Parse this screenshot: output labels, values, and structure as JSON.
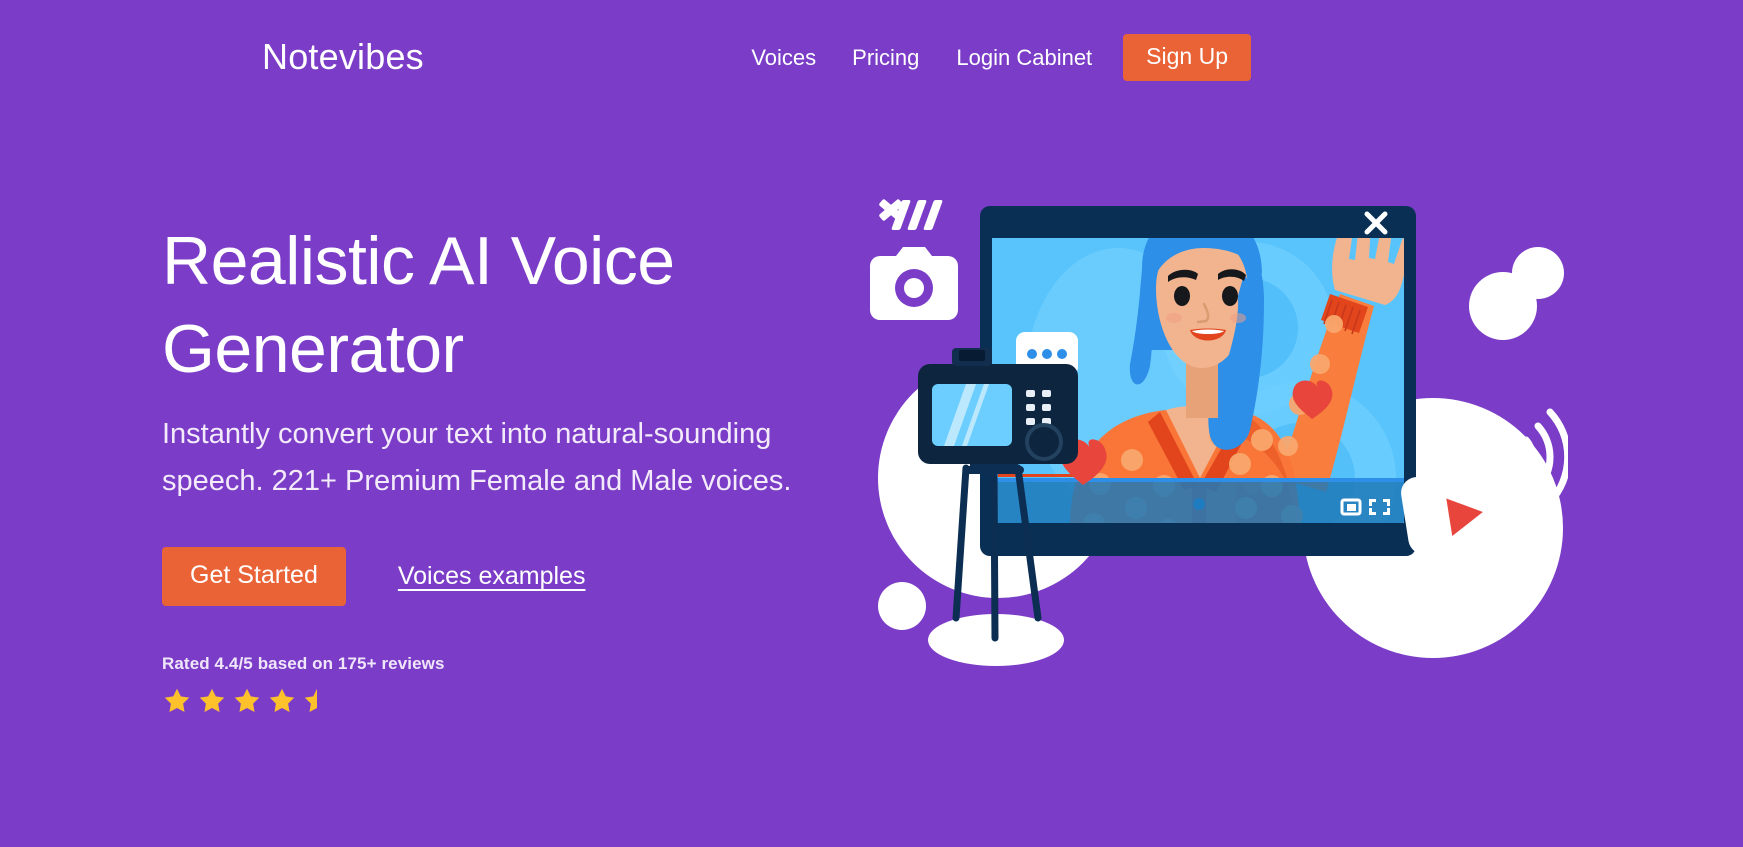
{
  "theme": {
    "background": "#7B3DC8",
    "accent_orange": "#EA6337",
    "text_white": "#FFFFFF",
    "star_gold": "#FCC12B",
    "frame_navy": "#092F55",
    "screen_blue": "#59C4FC",
    "heart_red": "#E8453C"
  },
  "header": {
    "brand": "Notevibes",
    "nav": [
      {
        "label": "Voices",
        "name": "nav-link-voices"
      },
      {
        "label": "Pricing",
        "name": "nav-link-pricing"
      },
      {
        "label": "Login Cabinet",
        "name": "nav-link-login-cabinet"
      }
    ],
    "signup_label": "Sign Up"
  },
  "hero": {
    "title": "Realistic AI Voice Generator",
    "subtitle": "Instantly convert your text into natural-sounding speech. 221+ Premium Female and Male voices.",
    "cta_primary": "Get Started",
    "cta_secondary": "Voices examples",
    "rating_text": "Rated 4.4/5 based on 175+ reviews",
    "rating_value": 4.4,
    "rating_max": 5,
    "review_count": "175+",
    "stars_full": 4,
    "stars_half": 1
  },
  "illustration": {
    "alt": "Woman with blue hair waving in a video call window with camera on tripod",
    "icons": [
      "close-icon",
      "camera-icon",
      "chat-bubble-icon",
      "heart-icon",
      "play-button-icon",
      "wifi-signal-icon",
      "picture-in-picture-icon",
      "fullscreen-icon"
    ]
  }
}
